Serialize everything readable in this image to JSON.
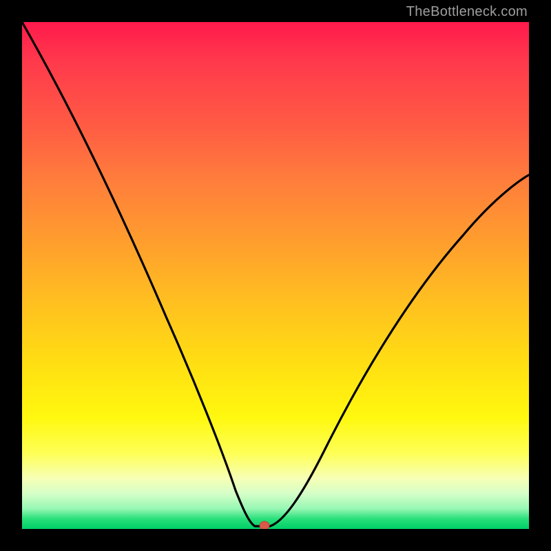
{
  "watermark": "TheBottleneck.com",
  "chart_data": {
    "type": "line",
    "title": "",
    "xlabel": "",
    "ylabel": "",
    "xlim": [
      0,
      100
    ],
    "ylim": [
      0,
      100
    ],
    "grid": false,
    "legend": false,
    "x": [
      0,
      4,
      8,
      12,
      16,
      20,
      24,
      28,
      32,
      36,
      39,
      41,
      43,
      45,
      47,
      49,
      51,
      54,
      58,
      62,
      66,
      70,
      74,
      78,
      82,
      86,
      90,
      94,
      98,
      100
    ],
    "values": [
      100,
      93,
      85,
      77,
      69,
      60,
      52,
      43,
      34,
      24,
      15,
      8,
      3,
      1,
      0,
      0,
      2,
      7,
      14,
      22,
      30,
      37,
      43,
      49,
      54,
      58,
      62,
      65,
      68,
      69
    ],
    "marker": {
      "x": 47,
      "y": 0
    },
    "background_gradient": "red-yellow-green vertical"
  }
}
